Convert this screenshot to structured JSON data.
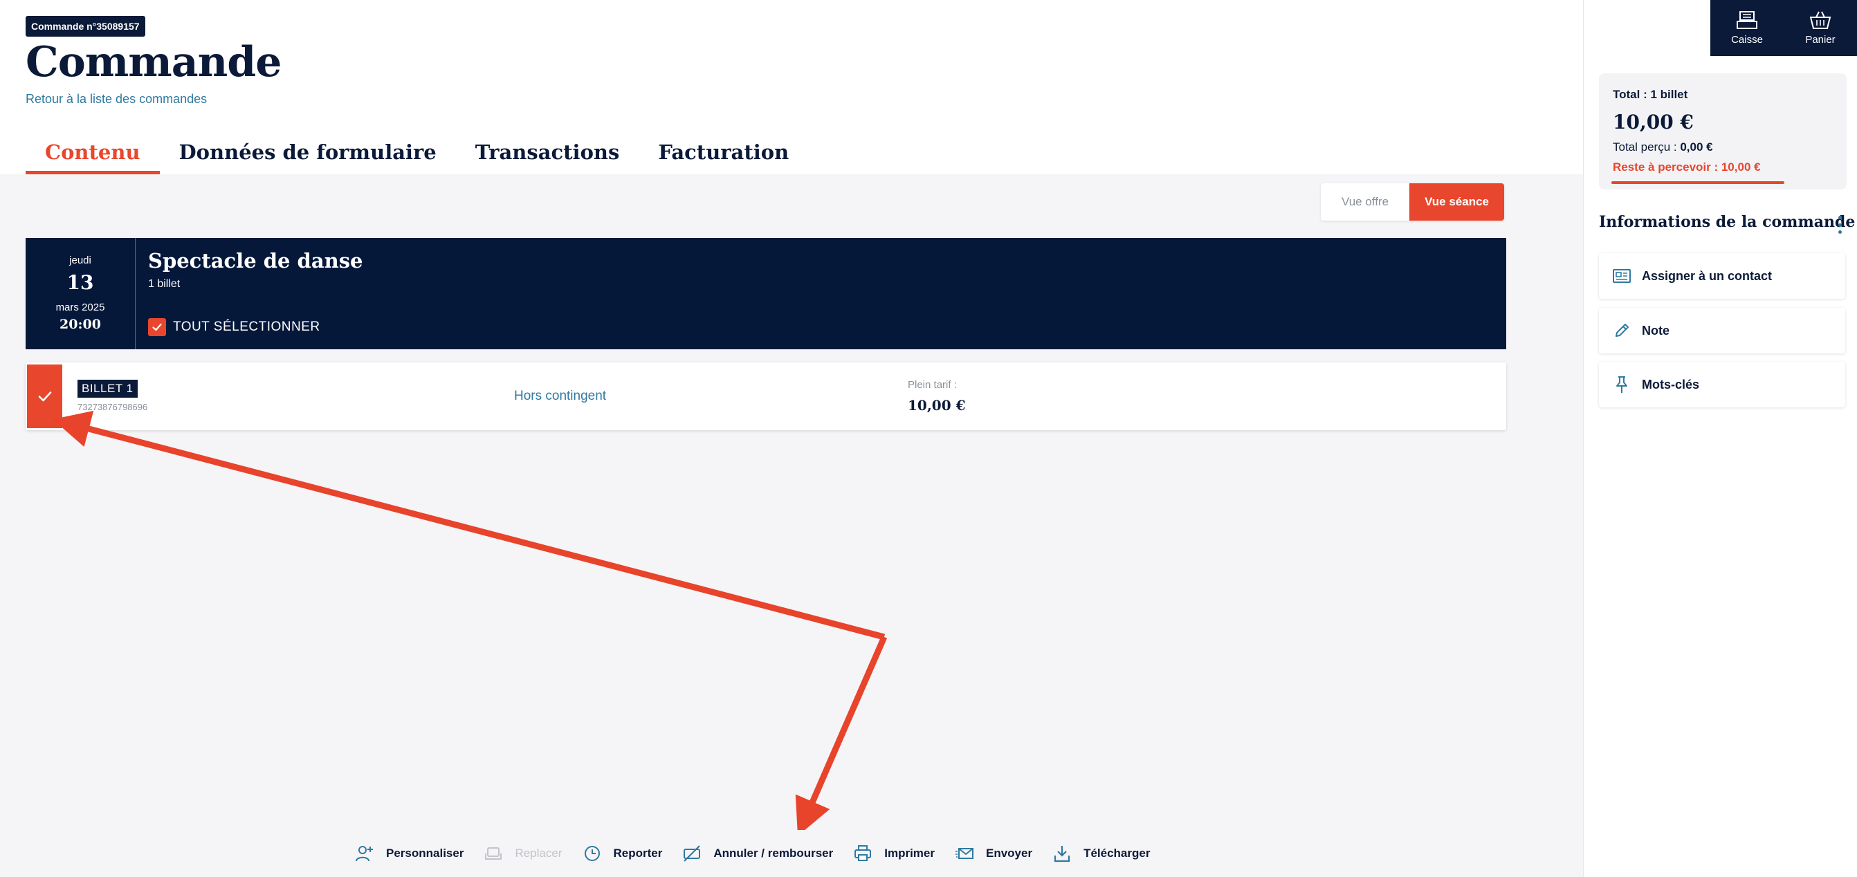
{
  "header": {
    "order_badge": "Commande n°35089157",
    "title": "Commande",
    "back_link": "Retour à la liste des commandes"
  },
  "tabs": [
    {
      "label": "Contenu",
      "active": true
    },
    {
      "label": "Données de formulaire",
      "active": false
    },
    {
      "label": "Transactions",
      "active": false
    },
    {
      "label": "Facturation",
      "active": false
    }
  ],
  "view_toggle": {
    "offer_label": "Vue offre",
    "session_label": "Vue séance",
    "selected": "Vue séance"
  },
  "session": {
    "day_of_week": "jeudi",
    "day": "13",
    "month_year": "mars 2025",
    "time": "20:00",
    "title": "Spectacle de danse",
    "ticket_count": "1 billet",
    "select_all_label": "TOUT SÉLECTIONNER",
    "select_all_checked": true
  },
  "ticket": {
    "name": "BILLET 1",
    "code": "73273876798696",
    "quota": "Hors contingent",
    "rate_label": "Plein tarif :",
    "rate_value": "10,00 €",
    "checked": true
  },
  "actions": {
    "personnaliser": "Personnaliser",
    "replacer": "Replacer",
    "reporter": "Reporter",
    "annuler": "Annuler / rembourser",
    "imprimer": "Imprimer",
    "envoyer": "Envoyer",
    "telecharger": "Télécharger"
  },
  "sidebar": {
    "caisse_label": "Caisse",
    "panier_label": "Panier",
    "summary": {
      "total_label": "Total : 1 billet",
      "total_value": "10,00 €",
      "received_label": "Total perçu : ",
      "received_value": "0,00 €",
      "remaining": "Reste à percevoir : 10,00 €"
    },
    "info_title": "Informations de la commande",
    "info_items": [
      {
        "label": "Assigner à un contact",
        "icon": "contact-card-icon"
      },
      {
        "label": "Note",
        "icon": "pencil-icon"
      },
      {
        "label": "Mots-clés",
        "icon": "pin-icon"
      }
    ]
  },
  "colors": {
    "accent": "#e8462d",
    "navy": "#0b1a38",
    "link": "#2f7aa0",
    "background": "#f5f4f6"
  }
}
